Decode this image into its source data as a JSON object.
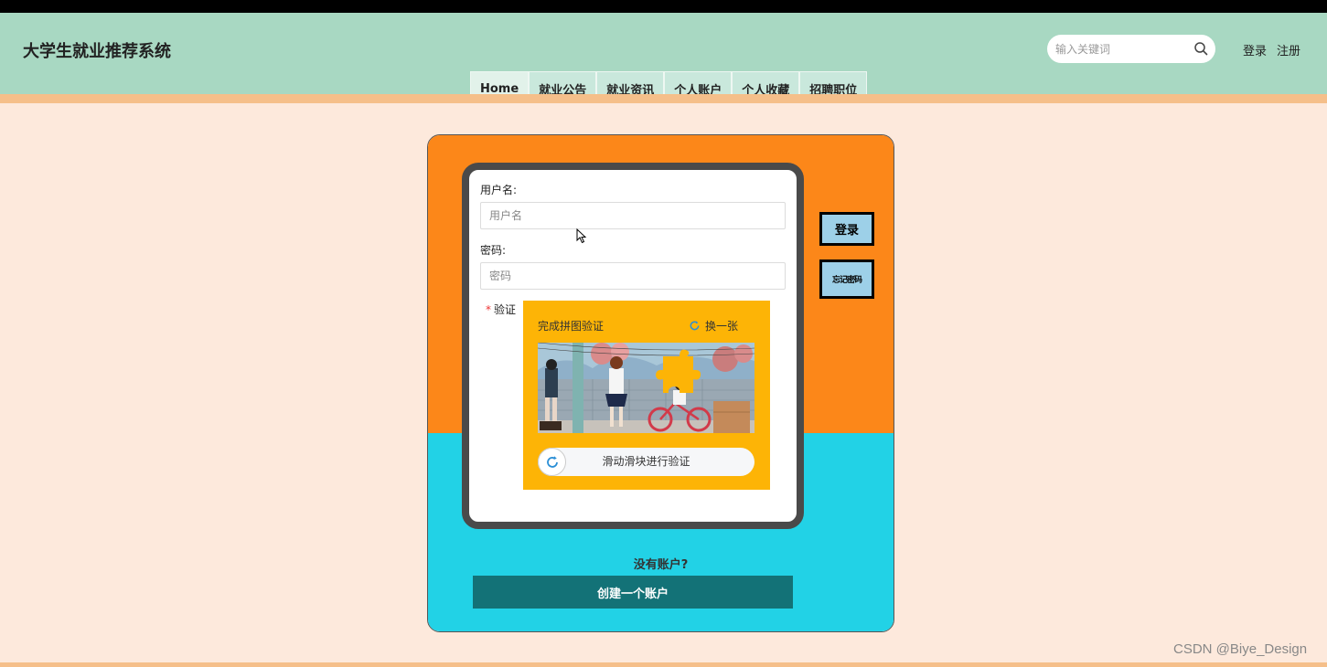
{
  "site": {
    "title": "大学生就业推荐系统"
  },
  "search": {
    "placeholder": "输入关键词"
  },
  "auth": {
    "login": "登录",
    "register": "注册"
  },
  "nav": {
    "items": [
      {
        "label": "Home"
      },
      {
        "label": "就业公告"
      },
      {
        "label": "就业资讯"
      },
      {
        "label": "个人账户"
      },
      {
        "label": "个人收藏"
      },
      {
        "label": "招聘职位"
      }
    ]
  },
  "form": {
    "username_label": "用户名:",
    "username_placeholder": "用户名",
    "password_label": "密码:",
    "password_placeholder": "密码",
    "captcha_label": "验证",
    "captcha_title": "完成拼图验证",
    "captcha_refresh": "换一张",
    "slider_text": "滑动滑块进行验证"
  },
  "buttons": {
    "login": "登录",
    "forgot": "忘记密码"
  },
  "signup": {
    "prompt": "没有账户?",
    "create": "创建一个账户"
  },
  "watermark": "CSDN @Biye_Design",
  "colors": {
    "header": "#a8d8c2",
    "card_top": "#fc8719",
    "card_bottom": "#22d2e6",
    "captcha_bg": "#fdb406",
    "create_button": "#137277",
    "side_button": "#9dd0e8"
  }
}
